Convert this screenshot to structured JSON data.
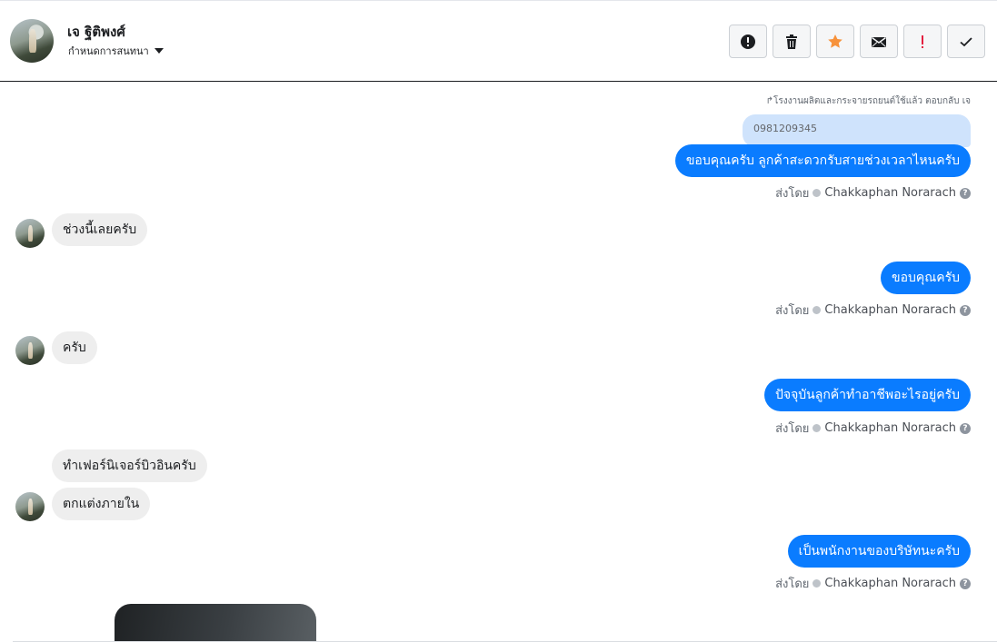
{
  "header": {
    "contact_name": "เจ ฐิติพงศ์",
    "assign_label": "กำหนดการสนทนา",
    "toolbar": [
      {
        "name": "report-spam-button",
        "icon": "alert-circle-icon",
        "color": "#1c1e21"
      },
      {
        "name": "delete-button",
        "icon": "trash-icon",
        "color": "#1c1e21"
      },
      {
        "name": "star-button",
        "icon": "star-icon",
        "color": "#f7923b"
      },
      {
        "name": "mark-unread-button",
        "icon": "envelope-icon",
        "color": "#1c1e21"
      },
      {
        "name": "follow-up-button",
        "icon": "exclamation-icon",
        "color": "#e41e3f"
      },
      {
        "name": "mark-done-button",
        "icon": "check-icon",
        "color": "#1c1e21"
      }
    ]
  },
  "thread": {
    "reply_note": "↱โรงงานผลิตและกระจายรถยนต์ใช้แล้ว ตอบกลับ เจ",
    "quoted_text": "0981209345",
    "sent_by_label": "ส่งโดย",
    "agent_name": "Chakkaphan Norarach",
    "messages": [
      {
        "dir": "out",
        "text": "ขอบคุณครับ ลูกค้าสะดวกรับสายช่วงเวลาไหนครับ"
      },
      {
        "dir": "in",
        "text": "ช่วงนี้เลยครับ"
      },
      {
        "dir": "out",
        "text": "ขอบคุณครับ"
      },
      {
        "dir": "in",
        "text": "ครับ"
      },
      {
        "dir": "out",
        "text": "ปัจจุบันลูกค้าทำอาชีพอะไรอยู่ครับ"
      },
      {
        "dir": "in",
        "text": "ทำเฟอร์นิเจอร์บิวอินครับ"
      },
      {
        "dir": "in",
        "text": "ตกแต่งภายใน"
      },
      {
        "dir": "out",
        "text": "เป็นพนักงานของบริษัทนะครับ"
      }
    ]
  },
  "colors": {
    "outgoing_bubble": "#0a7cff",
    "incoming_bubble": "#eeeeee",
    "quoted_bubble": "#cfe3fc",
    "star": "#f7923b",
    "follow_up": "#e41e3f"
  }
}
